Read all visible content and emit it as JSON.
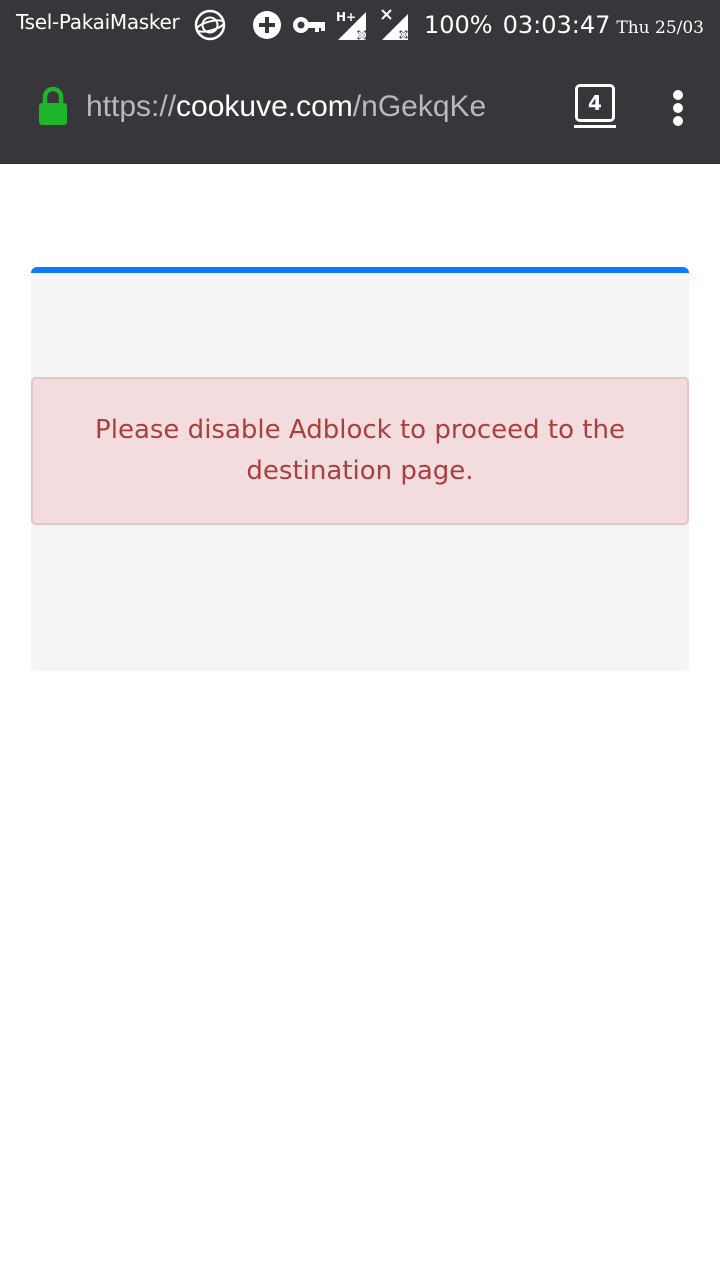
{
  "status_bar": {
    "carrier": "Tsel-PakaiMasker",
    "network_label": "H+",
    "battery": "100%",
    "time": "03:03:47",
    "date": "Thu 25/03"
  },
  "browser": {
    "url_scheme": "https://",
    "url_host": "cookuve.com",
    "url_path": "/nGekqKe",
    "tab_count": "4",
    "lock_color": "#1fb52a"
  },
  "page": {
    "accent_color": "#0a7bff",
    "alert_message": "Please disable Adblock to proceed to the destination page."
  }
}
